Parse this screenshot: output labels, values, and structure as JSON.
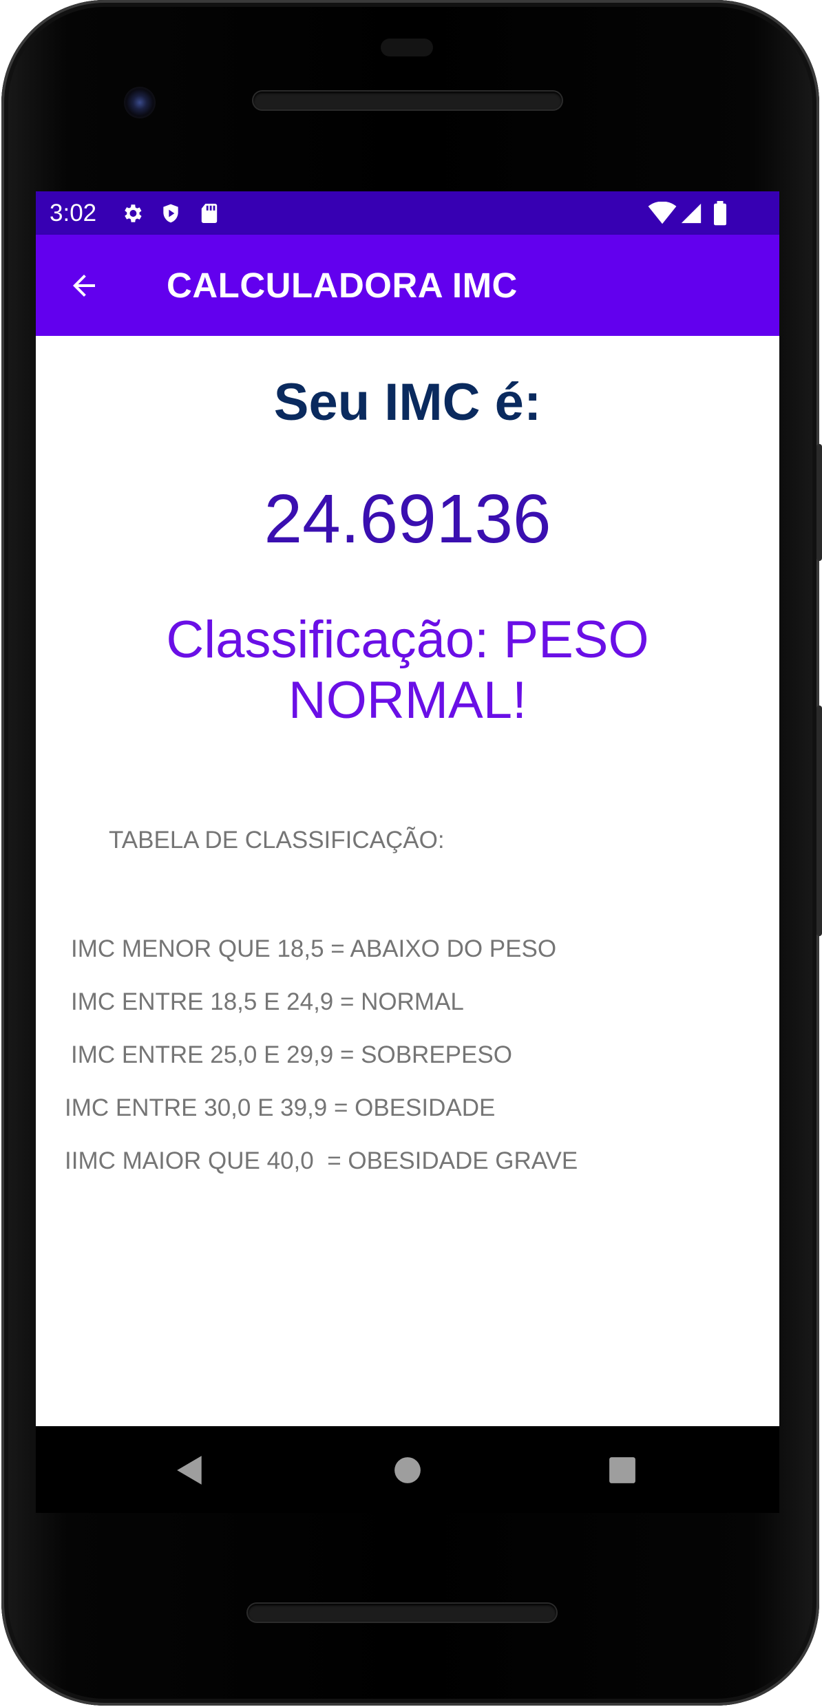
{
  "status_bar": {
    "time": "3:02",
    "icons_left": [
      "settings-icon",
      "play-protect-icon",
      "sd-card-icon"
    ],
    "icons_right": [
      "wifi-icon",
      "signal-icon",
      "battery-icon"
    ]
  },
  "app_bar": {
    "title": "CALCULADORA IMC",
    "back_icon": "arrow-back-icon"
  },
  "result": {
    "label": "Seu IMC é:",
    "value": "24.69136",
    "classification": "Classificação: PESO NORMAL!"
  },
  "table": {
    "title": "TABELA DE CLASSIFICAÇÃO:",
    "rows": [
      "IMC MENOR QUE 18,5 = ABAIXO DO PESO",
      "IMC ENTRE 18,5 E 24,9 = NORMAL",
      "IMC ENTRE 25,0 E 29,9 = SOBREPESO",
      "IMC ENTRE 30,0 E 39,9 = OBESIDADE",
      "IIMC MAIOR QUE 40,0  = OBESIDADE GRAVE"
    ]
  },
  "nav_bar": {
    "buttons": [
      "back-triangle-icon",
      "home-circle-icon",
      "recents-square-icon"
    ]
  },
  "colors": {
    "status_bar": "#3700b3",
    "app_bar": "#6200ee",
    "imc_label": "#0a2a5e",
    "imc_value": "#3a0fb0",
    "classification": "#6a0fe6",
    "table_text": "#757575"
  }
}
